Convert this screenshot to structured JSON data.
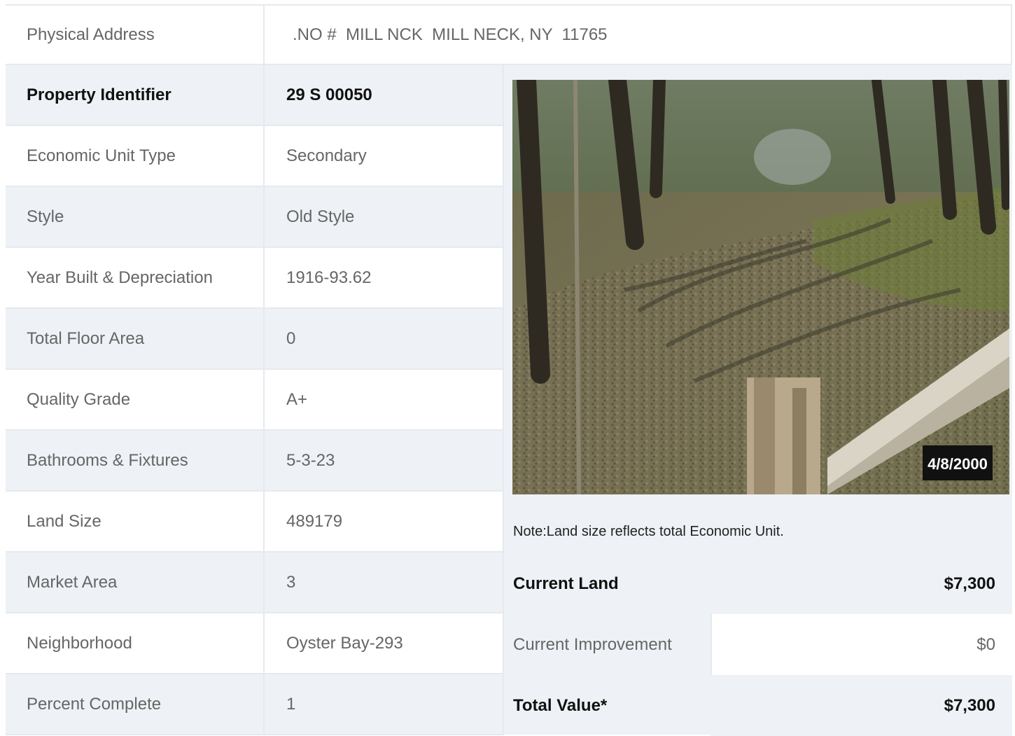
{
  "address": {
    "label": "Physical Address",
    "value": ".NO #  MILL NCK  MILL NECK, NY  11765"
  },
  "property_rows": [
    {
      "label": "Property Identifier",
      "value": "29  S  00050",
      "bold": true
    },
    {
      "label": "Economic Unit Type",
      "value": "Secondary"
    },
    {
      "label": "Style",
      "value": "Old Style"
    },
    {
      "label": "Year Built & Depreciation",
      "value": "1916-93.62"
    },
    {
      "label": "Total Floor Area",
      "value": "0"
    },
    {
      "label": "Quality Grade",
      "value": "A+"
    },
    {
      "label": "Bathrooms & Fixtures",
      "value": "5-3-23"
    },
    {
      "label": "Land Size",
      "value": "489179"
    },
    {
      "label": "Market Area",
      "value": "3"
    },
    {
      "label": "Neighborhood",
      "value": "Oyster Bay-293"
    },
    {
      "label": "Percent Complete",
      "value": "1"
    }
  ],
  "photo": {
    "date_stamp": "4/8/2000"
  },
  "note": "Note:Land size reflects total Economic Unit.",
  "values": [
    {
      "label": "Current Land",
      "amount": "$7,300",
      "bold": true
    },
    {
      "label": "Current Improvement",
      "amount": "$0",
      "bold": false
    },
    {
      "label": "Total Value*",
      "amount": "$7,300",
      "bold": true
    }
  ]
}
